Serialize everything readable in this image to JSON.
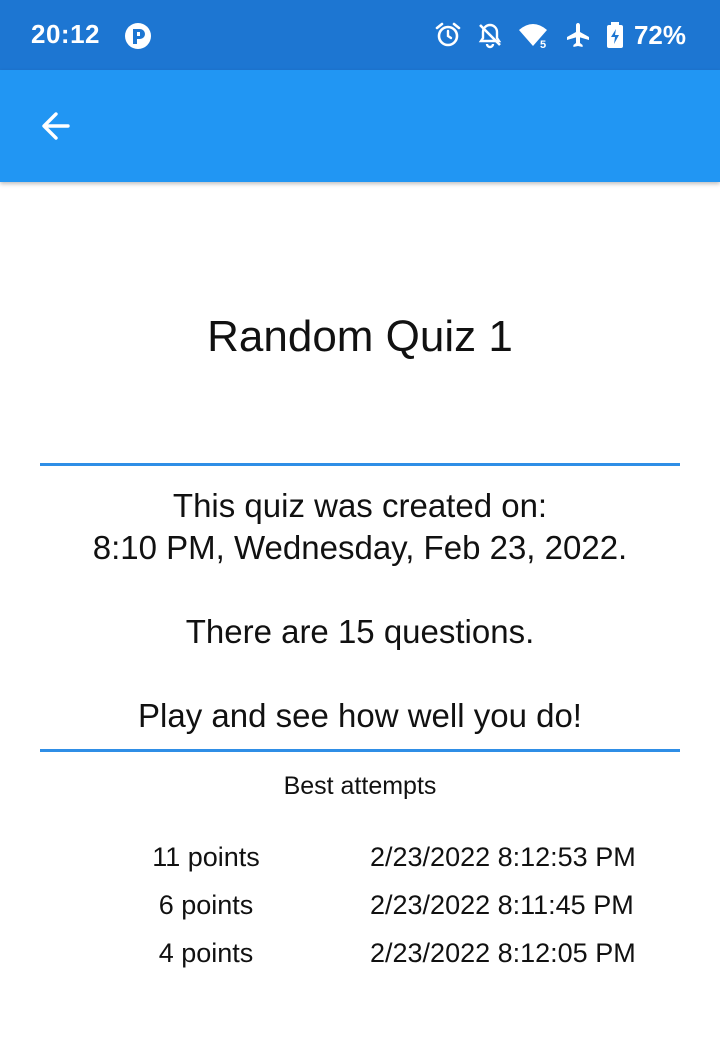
{
  "status_bar": {
    "time": "20:12",
    "battery": "72%",
    "icons": [
      "app-notification-icon",
      "alarm-icon",
      "notifications-off-icon",
      "wifi-icon",
      "airplane-mode-icon",
      "battery-charging-icon"
    ],
    "background": "#1d76d2"
  },
  "app_bar": {
    "back_icon": "arrow-back-icon",
    "background": "#2196f3"
  },
  "quiz": {
    "title": "Random Quiz 1",
    "created_label": "This quiz was created on:",
    "created_date": "8:10 PM, Wednesday, Feb 23, 2022.",
    "questions_text": "There are 15 questions.",
    "cta_text": "Play and see how well you do!"
  },
  "best_attempts": {
    "heading": "Best attempts",
    "rows": [
      {
        "points": "11 points",
        "date": "2/23/2022 8:12:53 PM"
      },
      {
        "points": "6 points",
        "date": "2/23/2022 8:11:45 PM"
      },
      {
        "points": "4 points",
        "date": "2/23/2022 8:12:05 PM"
      }
    ]
  },
  "colors": {
    "divider": "#2f8ee6"
  }
}
